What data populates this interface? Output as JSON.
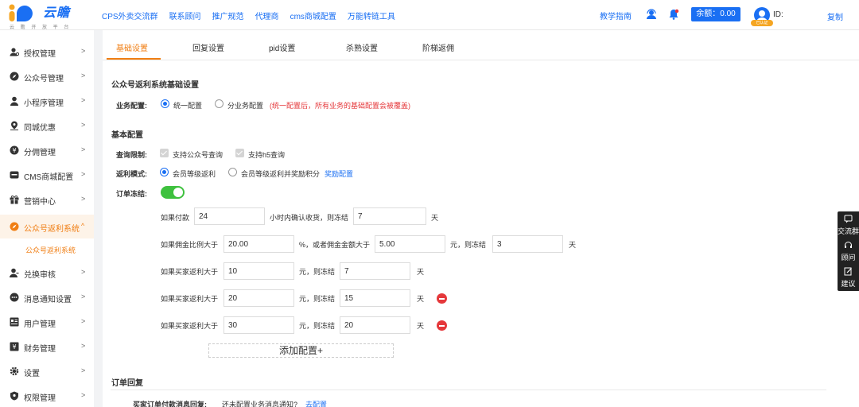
{
  "brand": {
    "name": "云瞻",
    "subtitle": "云 瞻 开 放 平 台"
  },
  "topnav": [
    "CPS外卖交流群",
    "联系顾问",
    "推广规范",
    "代理商",
    "cms商城配置",
    "万能转链工具"
  ],
  "header": {
    "guide": "教学指南",
    "balance": "余额：0.00",
    "badge": "已认证",
    "id_label": "ID:",
    "copy": "复制"
  },
  "sidebar": {
    "items": [
      {
        "label": "授权管理",
        "icon": "key-user-icon"
      },
      {
        "label": "公众号管理",
        "icon": "compass-icon"
      },
      {
        "label": "小程序管理",
        "icon": "user-icon"
      },
      {
        "label": "同城优惠",
        "icon": "location-icon"
      },
      {
        "label": "分佣管理",
        "icon": "money-icon"
      },
      {
        "label": "CMS商城配置",
        "icon": "cms-icon"
      },
      {
        "label": "营销中心",
        "icon": "gift-icon"
      },
      {
        "label": "公众号返利系统",
        "icon": "compass-icon",
        "active": true
      },
      {
        "label": "兑换审核",
        "icon": "user-check-icon"
      },
      {
        "label": "消息通知设置",
        "icon": "chat-icon"
      },
      {
        "label": "用户管理",
        "icon": "users-icon"
      },
      {
        "label": "财务管理",
        "icon": "finance-icon"
      },
      {
        "label": "设置",
        "icon": "gear-icon"
      },
      {
        "label": "权限管理",
        "icon": "shield-icon"
      }
    ],
    "sub_active": "公众号返利系统"
  },
  "tabs": [
    "基础设置",
    "回复设置",
    "pid设置",
    "杀熟设置",
    "阶梯返佣"
  ],
  "section1": {
    "title": "公众号返利系统基础设置",
    "business_label": "业务配置:",
    "opt_unified": "统一配置",
    "opt_per": "分业务配置",
    "warning": "(统一配置后，所有业务的基础配置会被覆盖)"
  },
  "section2": {
    "title": "基本配置",
    "query_label": "查询限制:",
    "query_opt1": "支持公众号查询",
    "query_opt2": "支持h5查询",
    "rebate_label": "返利模式:",
    "rebate_opt1": "会员等级返利",
    "rebate_opt2": "会员等级返利并奖励积分",
    "reward_link": "奖励配置",
    "freeze_label": "订单冻结:"
  },
  "rules": {
    "row1": {
      "prefix": "如果付款",
      "v1": "24",
      "mid": "小时内确认收货，则冻结",
      "v2": "7",
      "unit": "天"
    },
    "row2": {
      "prefix": "如果佣金比例大于",
      "v1": "20.00",
      "mid1": "%，或者佣金金额大于",
      "v2": "5.00",
      "mid2": "元，则冻结",
      "v3": "3",
      "unit": "天"
    },
    "rebate_rows": [
      {
        "prefix": "如果买家返利大于",
        "v1": "10",
        "mid": "元，则冻结",
        "v2": "7",
        "unit": "天"
      },
      {
        "prefix": "如果买家返利大于",
        "v1": "20",
        "mid": "元，则冻结",
        "v2": "15",
        "unit": "天"
      },
      {
        "prefix": "如果买家返利大于",
        "v1": "30",
        "mid": "元，则冻结",
        "v2": "20",
        "unit": "天"
      }
    ],
    "add_button": "添加配置+"
  },
  "section3": {
    "title": "订单回复",
    "pay_label": "买家订单付款消息回复:",
    "pay_text": "还未配置业务消息通知?",
    "pay_link": "去配置"
  },
  "float": [
    "交流群",
    "顾问",
    "建议"
  ],
  "colors": {
    "accent": "#f07e13",
    "primary": "#1a6ff3",
    "danger": "#e5383b",
    "switch_on": "#3ec13e"
  }
}
